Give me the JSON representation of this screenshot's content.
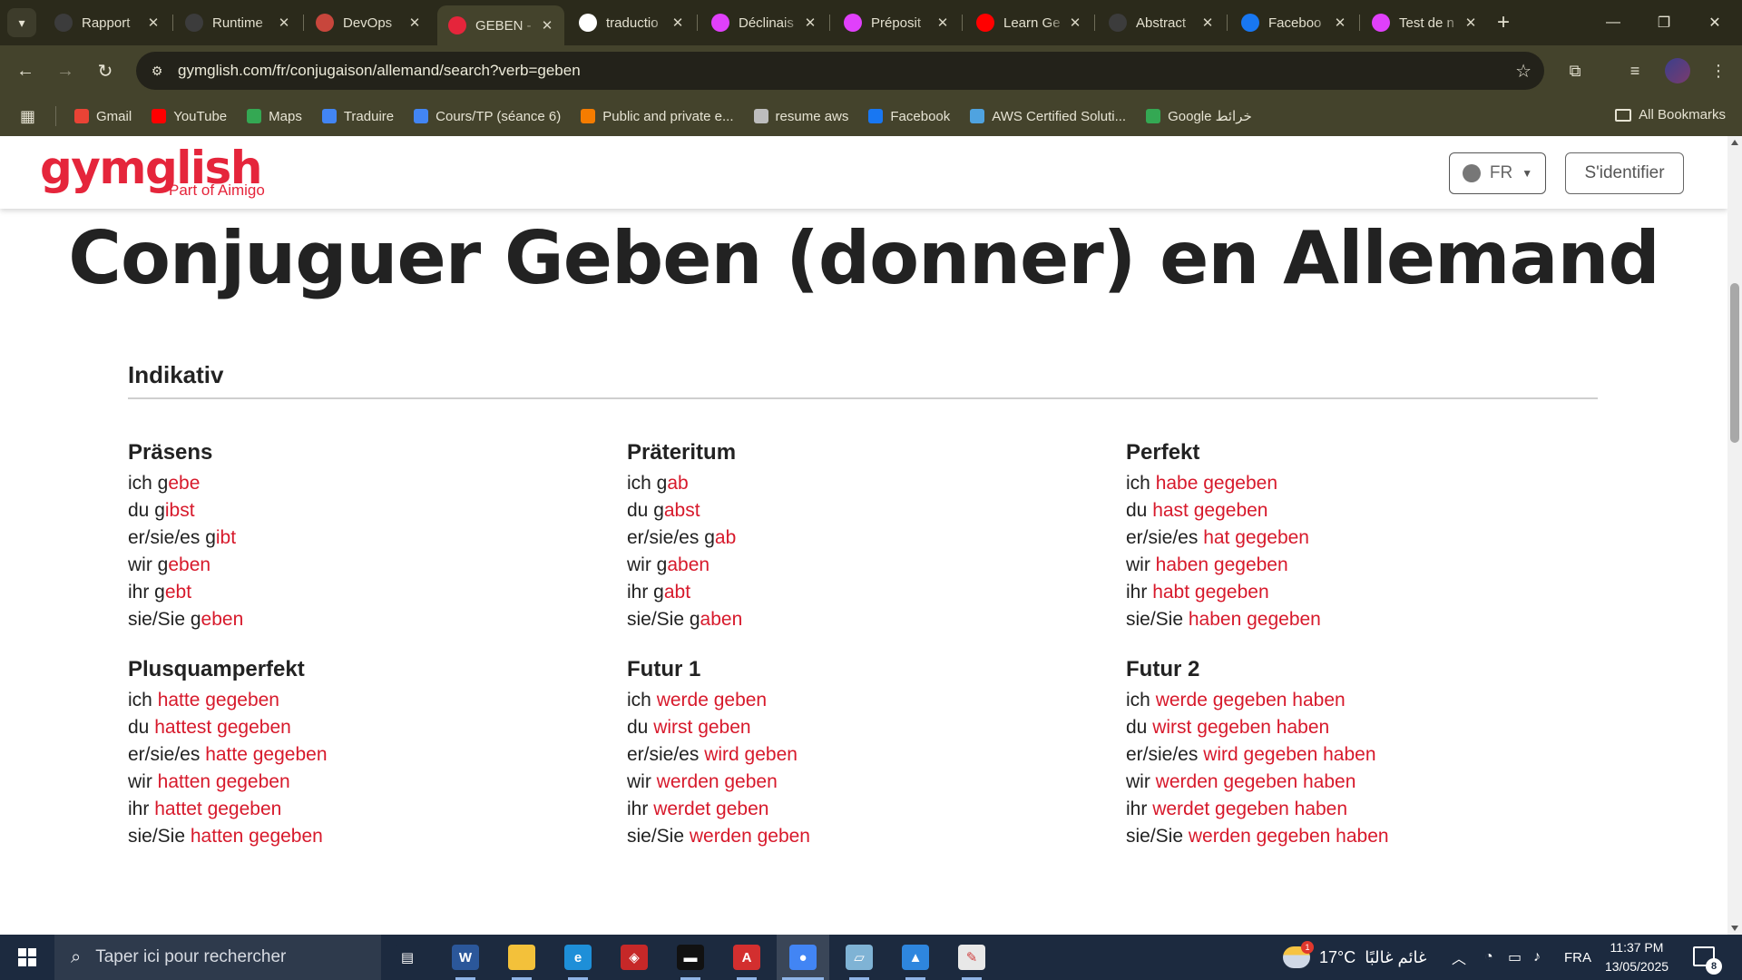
{
  "browser": {
    "tabs": [
      {
        "title": "Rapport",
        "favicon": "chatgpt-icon",
        "color": "#3c3c3c"
      },
      {
        "title": "Runtime",
        "favicon": "chatgpt-icon",
        "color": "#3c3c3c"
      },
      {
        "title": "DevOps",
        "favicon": "devops-heart-icon",
        "color": "#c8463c"
      },
      {
        "title": "GEBEN - ",
        "favicon": "gymglish-g-icon",
        "color": "#e5253b",
        "active": true
      },
      {
        "title": "traductio",
        "favicon": "google-icon",
        "color": "#ffffff"
      },
      {
        "title": "Déclinais",
        "favicon": "colorful-square-icon",
        "color": "#e040fb"
      },
      {
        "title": "Préposit",
        "favicon": "colorful-square-icon",
        "color": "#e040fb"
      },
      {
        "title": "Learn Ge",
        "favicon": "youtube-icon",
        "color": "#ff0000"
      },
      {
        "title": "Abstract",
        "favicon": "chatgpt-icon",
        "color": "#3c3c3c"
      },
      {
        "title": "Faceboo",
        "favicon": "facebook-icon",
        "color": "#1877f2"
      },
      {
        "title": "Test de n",
        "favicon": "colorful-square-icon",
        "color": "#e040fb"
      }
    ],
    "url": "gymglish.com/fr/conjugaison/allemand/search?verb=geben",
    "bookmarks": [
      {
        "label": "Gmail",
        "icon": "gmail-icon",
        "color": "#ea4335"
      },
      {
        "label": "YouTube",
        "icon": "youtube-icon",
        "color": "#ff0000"
      },
      {
        "label": "Maps",
        "icon": "maps-icon",
        "color": "#34a853"
      },
      {
        "label": "Traduire",
        "icon": "translate-icon",
        "color": "#4285f4"
      },
      {
        "label": "Cours/TP (séance 6)",
        "icon": "classroom-icon",
        "color": "#4285f4"
      },
      {
        "label": "Public and private e...",
        "icon": "presentation-icon",
        "color": "#f57c00"
      },
      {
        "label": "resume aws",
        "icon": "chatgpt-icon",
        "color": "#bdbdbd"
      },
      {
        "label": "Facebook",
        "icon": "facebook-icon",
        "color": "#1877f2"
      },
      {
        "label": "AWS Certified Soluti...",
        "icon": "list-icon",
        "color": "#4fa3e0"
      },
      {
        "label": "Google خرائط",
        "icon": "maps-icon",
        "color": "#34a853"
      }
    ],
    "all_bookmarks": "All Bookmarks"
  },
  "site": {
    "logo": "gymglish",
    "logo_sub": "Part of Aimigo",
    "lang": "FR",
    "login": "S'identifier",
    "accent": "#e5253b"
  },
  "page": {
    "title": "Conjuguer Geben (donner) en Allemand",
    "section": "Indikativ",
    "tenses": [
      {
        "name": "Präsens",
        "rows": [
          {
            "pre": "ich g",
            "form": "ebe",
            "gap": ""
          },
          {
            "pre": "du g",
            "form": "ibst",
            "gap": ""
          },
          {
            "pre": "er/sie/es g",
            "form": "ibt",
            "gap": ""
          },
          {
            "pre": "wir g",
            "form": "eben",
            "gap": ""
          },
          {
            "pre": "ihr g",
            "form": "ebt",
            "gap": ""
          },
          {
            "pre": "sie/Sie g",
            "form": "eben",
            "gap": ""
          }
        ]
      },
      {
        "name": "Präteritum",
        "rows": [
          {
            "pre": "ich g",
            "form": "ab"
          },
          {
            "pre": "du g",
            "form": "abst"
          },
          {
            "pre": "er/sie/es g",
            "form": "ab"
          },
          {
            "pre": "wir g",
            "form": "aben"
          },
          {
            "pre": "ihr g",
            "form": "abt"
          },
          {
            "pre": "sie/Sie g",
            "form": "aben"
          }
        ]
      },
      {
        "name": "Perfekt",
        "rows": [
          {
            "pre": "ich ",
            "form": "habe gegeben"
          },
          {
            "pre": "du ",
            "form": "hast gegeben"
          },
          {
            "pre": "er/sie/es ",
            "form": "hat gegeben"
          },
          {
            "pre": "wir ",
            "form": "haben gegeben"
          },
          {
            "pre": "ihr ",
            "form": "habt gegeben"
          },
          {
            "pre": "sie/Sie ",
            "form": "haben gegeben"
          }
        ]
      },
      {
        "name": "Plusquamperfekt",
        "rows": [
          {
            "pre": "ich ",
            "form": "hatte gegeben"
          },
          {
            "pre": "du ",
            "form": "hattest gegeben"
          },
          {
            "pre": "er/sie/es ",
            "form": "hatte gegeben"
          },
          {
            "pre": "wir ",
            "form": "hatten gegeben"
          },
          {
            "pre": "ihr ",
            "form": "hattet gegeben"
          },
          {
            "pre": "sie/Sie ",
            "form": "hatten gegeben"
          }
        ]
      },
      {
        "name": "Futur 1",
        "rows": [
          {
            "pre": "ich ",
            "form": "werde geben"
          },
          {
            "pre": "du ",
            "form": "wirst geben"
          },
          {
            "pre": "er/sie/es ",
            "form": "wird geben"
          },
          {
            "pre": "wir ",
            "form": "werden geben"
          },
          {
            "pre": "ihr ",
            "form": "werdet geben"
          },
          {
            "pre": "sie/Sie ",
            "form": "werden geben"
          }
        ]
      },
      {
        "name": "Futur 2",
        "rows": [
          {
            "pre": "ich ",
            "form": "werde gegeben haben"
          },
          {
            "pre": "du ",
            "form": "wirst gegeben haben"
          },
          {
            "pre": "er/sie/es ",
            "form": "wird gegeben haben"
          },
          {
            "pre": "wir ",
            "form": "werden gegeben haben"
          },
          {
            "pre": "ihr ",
            "form": "werdet gegeben haben"
          },
          {
            "pre": "sie/Sie ",
            "form": "werden gegeben haben"
          }
        ]
      }
    ]
  },
  "taskbar": {
    "search_placeholder": "Taper ici pour rechercher",
    "apps": [
      {
        "name": "task-view-icon",
        "color": "#1c2a3f",
        "glyph": "▤"
      },
      {
        "name": "word-icon",
        "color": "#2b579a",
        "glyph": "W"
      },
      {
        "name": "file-explorer-icon",
        "color": "#f3c13a",
        "glyph": ""
      },
      {
        "name": "edge-icon",
        "color": "#1e8fd8",
        "glyph": "e"
      },
      {
        "name": "app-red-icon",
        "color": "#c62828",
        "glyph": "◈"
      },
      {
        "name": "terminal-icon",
        "color": "#111111",
        "glyph": "▬"
      },
      {
        "name": "acrobat-icon",
        "color": "#d32f2f",
        "glyph": "A"
      },
      {
        "name": "chrome-icon",
        "color": "#4285f4",
        "glyph": "●"
      },
      {
        "name": "notepad-icon",
        "color": "#7fb3d5",
        "glyph": "▱"
      },
      {
        "name": "photos-icon",
        "color": "#2e86de",
        "glyph": "▲"
      },
      {
        "name": "paint-icon",
        "color": "#e8e8e8",
        "glyph": "✎"
      }
    ],
    "weather_temp": "17°C",
    "weather_text": "غائم غالبًا",
    "weather_badge": "1",
    "lang": "FRA",
    "time": "11:37 PM",
    "date": "13/05/2025",
    "notifications": "8"
  }
}
